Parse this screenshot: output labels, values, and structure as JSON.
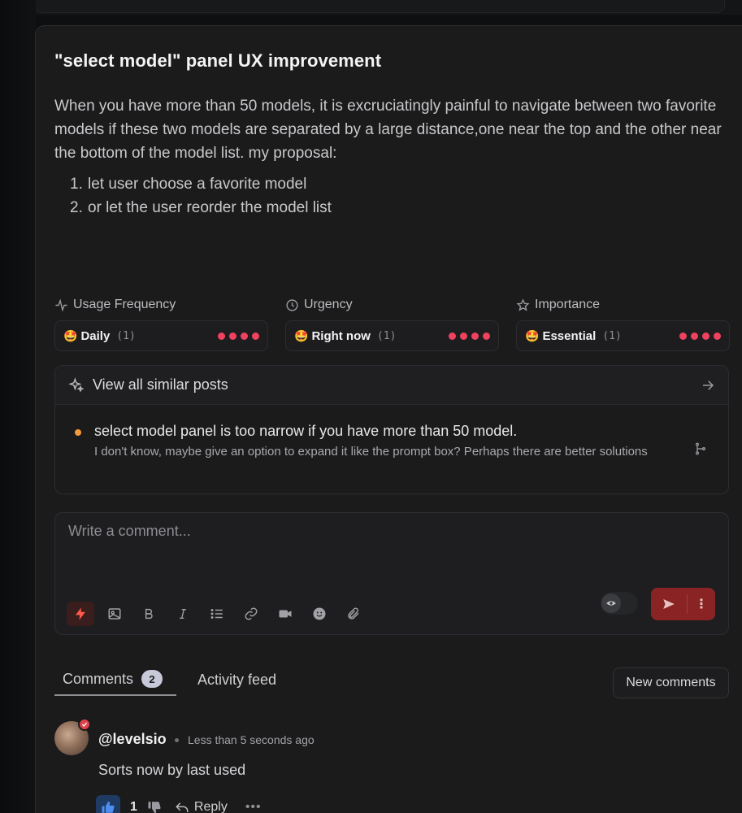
{
  "post": {
    "title": "\"select model\" panel UX improvement",
    "description": "When you have more than 50 models, it is excruciatingly painful to navigate between two favorite models if these two models are separated by a large distance,one near the top and the other near the bottom of the model list. my proposal:",
    "list": [
      {
        "num": "1.",
        "text": "let user choose a favorite model"
      },
      {
        "num": "2.",
        "text": "or let the user reorder the model list"
      }
    ]
  },
  "meta": [
    {
      "label": "Usage Frequency",
      "icon": "activity-icon",
      "value": "Daily",
      "count": "(1)",
      "emoji": "🤩"
    },
    {
      "label": "Urgency",
      "icon": "clock-icon",
      "value": "Right now",
      "count": "(1)",
      "emoji": "🤩"
    },
    {
      "label": "Importance",
      "icon": "star-icon",
      "value": "Essential",
      "count": "(1)",
      "emoji": "🤩"
    }
  ],
  "similar": {
    "label": "View all similar posts",
    "item_title": "select model panel is too narrow if you have more than 50 model.",
    "item_sub": "I don't know, maybe give an option to expand it like the prompt box? Perhaps there are better solutions"
  },
  "composer": {
    "placeholder": "Write a comment..."
  },
  "tabs": {
    "comments_label": "Comments",
    "comments_count": "2",
    "activity_label": "Activity feed",
    "new_comments_label": "New comments"
  },
  "comment": {
    "author": "@levelsio",
    "time": "Less than 5 seconds ago",
    "text": "Sorts now by last used",
    "likes": "1",
    "reply_label": "Reply",
    "more_label": "•••"
  },
  "colors": {
    "accent_red": "#f0425f",
    "bullet_orange": "#f59a3a",
    "send_red": "#8a2424"
  }
}
